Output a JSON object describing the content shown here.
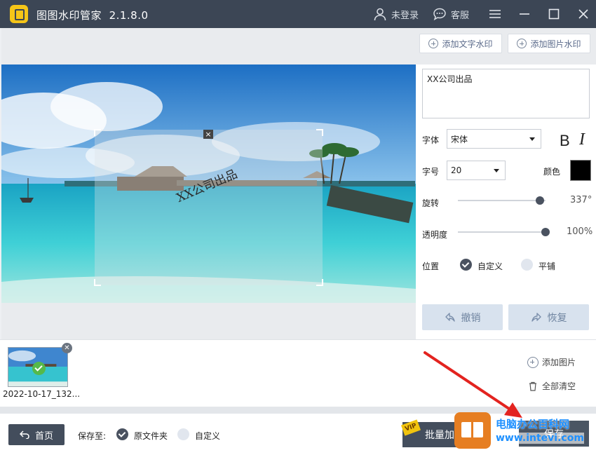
{
  "titlebar": {
    "app_name": "图图水印管家",
    "version": "2.1.8.0",
    "user_label": "未登录",
    "service_label": "客服"
  },
  "toolbar": {
    "add_text_watermark": "添加文字水印",
    "add_image_watermark": "添加图片水印"
  },
  "preview": {
    "watermark_text": "XX公司出品",
    "close_glyph": "×"
  },
  "settings": {
    "text_value": "XX公司出品",
    "font_label": "字体",
    "font_value": "宋体",
    "bold_label": "B",
    "italic_label": "I",
    "size_label": "字号",
    "size_value": "20",
    "color_label": "颜色",
    "color_value": "#000000",
    "rotate_label": "旋转",
    "rotate_value": "337°",
    "rotate_fraction": 0.936,
    "opacity_label": "透明度",
    "opacity_value": "100%",
    "opacity_fraction": 1.0,
    "position_label": "位置",
    "position_options": [
      "自定义",
      "平铺"
    ],
    "position_selected": "自定义",
    "undo_label": "撤销",
    "redo_label": "恢复"
  },
  "thumbnails": {
    "items": [
      {
        "name": "2022-10-17_132...",
        "checked": true
      }
    ],
    "add_image": "添加图片",
    "clear_all": "全部清空"
  },
  "bottombar": {
    "home_label": "首页",
    "save_to_label": "保存至:",
    "save_options": [
      "原文件夹",
      "自定义"
    ],
    "save_selected": "原文件夹",
    "batch_label": "批量加",
    "vip_label": "VIP",
    "save_label": "保存"
  },
  "overlay": {
    "site_name": "电脑办公百科网",
    "site_url": "www.intevi.com"
  },
  "colors": {
    "titlebar": "#3c4655",
    "accent_dark": "#4a5260",
    "check_green": "#55b94a",
    "arrow_red": "#e3231f",
    "overlay_blue": "#1e90ff"
  }
}
